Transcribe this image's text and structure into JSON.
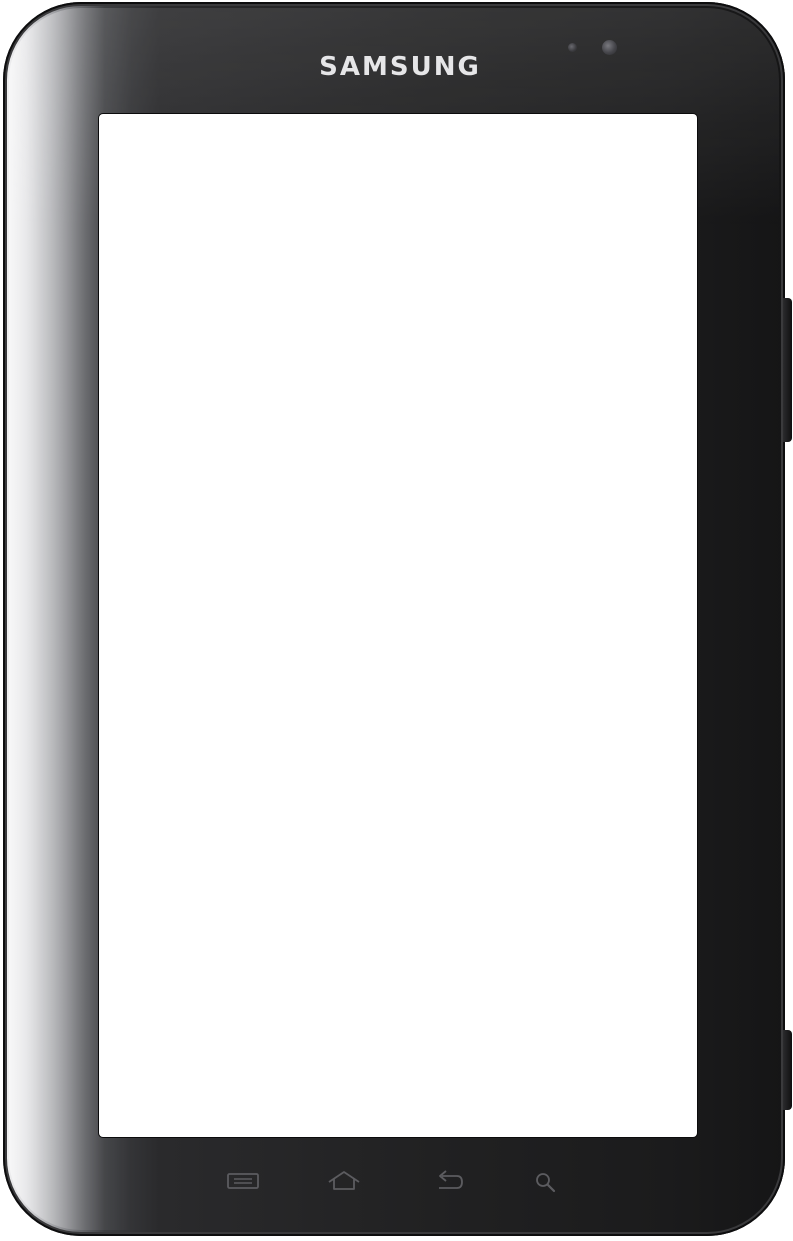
{
  "device": {
    "brand_label": "SAMSUNG",
    "bezel_color": "#212122",
    "screen_color": "#ffffff",
    "softkeys": [
      {
        "name": "menu-icon"
      },
      {
        "name": "home-icon"
      },
      {
        "name": "back-icon"
      },
      {
        "name": "search-icon"
      }
    ]
  }
}
